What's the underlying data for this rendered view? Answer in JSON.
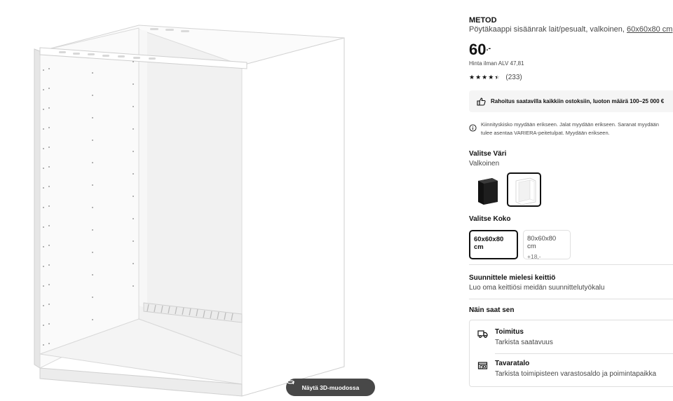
{
  "product": {
    "brand": "METOD",
    "description": "Pöytäkaappi sisäänrak lait/pesualt, valkoinen,",
    "size_link": "60x60x80 cm",
    "price_whole": "60",
    "price_suffix": ".-",
    "vat_text": "Hinta ilman ALV 47,81",
    "rating_value": 4.5,
    "rating_count": "(233)"
  },
  "viewer": {
    "button_3d_label": "Näytä 3D-muodossa"
  },
  "finance": {
    "text": "Rahoitus saatavilla kaikkiin ostoksiin, luoton määrä 100–25 000 €"
  },
  "note": {
    "line1": "Kiinnityskisko myydään erikseen. Jalat myydään erikseen. Saranat myydään",
    "line2": "tulee asentaa VARIERA-peitetulpat. Myydään erikseen."
  },
  "color": {
    "label": "Valitse Väri",
    "value": "Valkoinen",
    "options": [
      {
        "name": "musta",
        "color": "#1a1a1a",
        "selected": false
      },
      {
        "name": "valkoinen",
        "color": "#ffffff",
        "selected": true
      }
    ]
  },
  "size": {
    "label": "Valitse Koko",
    "options": [
      {
        "label": "60x60x80 cm",
        "extra": "",
        "selected": true
      },
      {
        "label": "80x60x80 cm",
        "extra": "+18,-",
        "selected": false
      }
    ]
  },
  "planner": {
    "title": "Suunnittele mielesi keittiö",
    "subtitle": "Luo oma keittiösi meidän suunnittelutyökalu"
  },
  "get_it": {
    "title": "Näin saat sen",
    "delivery": {
      "title": "Toimitus",
      "subtitle": "Tarkista saatavuus",
      "icon": "truck-icon"
    },
    "store": {
      "title": "Tavaratalo",
      "subtitle": "Tarkista toimipisteen varastosaldo ja poimintapaikka",
      "icon": "store-icon"
    }
  },
  "colors": {
    "text": "#111111",
    "secondary_text": "#484848",
    "border": "#dfdfdf",
    "panel_bg": "#f5f5f5",
    "button_3d_bg": "#484848"
  }
}
